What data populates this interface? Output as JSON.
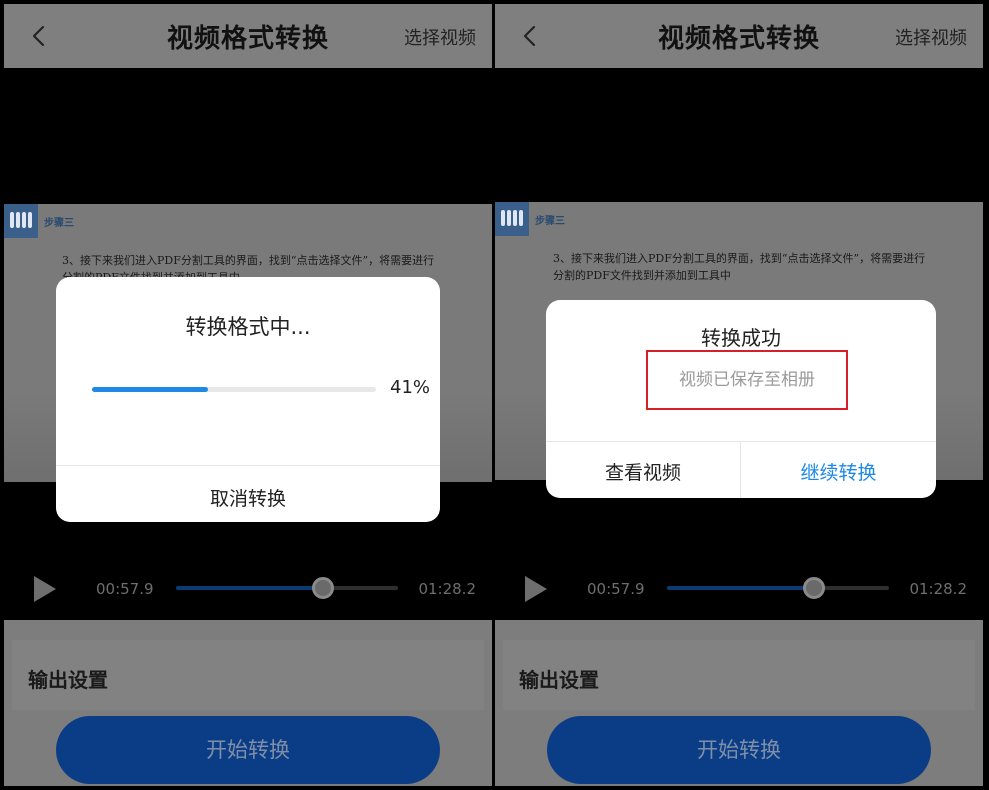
{
  "left": {
    "header": {
      "title": "视频格式转换",
      "select_label": "选择视频"
    },
    "slide": {
      "step": "步骤三",
      "text": "3、接下来我们进入PDF分割工具的界面，找到“点击选择文件”，将需要进行分割的PDF文件找到并添加到工具中"
    },
    "player": {
      "current_time": "00:57.9",
      "total_time": "01:28.2",
      "seek_fraction": 0.66
    },
    "output": {
      "label": "输出设置"
    },
    "start_button": "开始转换",
    "dialog": {
      "title": "转换格式中...",
      "progress_percent": 41,
      "progress_label": "41%",
      "cancel_label": "取消转换"
    }
  },
  "right": {
    "header": {
      "title": "视频格式转换",
      "select_label": "选择视频"
    },
    "slide": {
      "step": "步骤三",
      "text": "3、接下来我们进入PDF分割工具的界面，找到“点击选择文件”，将需要进行分割的PDF文件找到并添加到工具中"
    },
    "player": {
      "current_time": "00:57.9",
      "total_time": "01:28.2",
      "seek_fraction": 0.66
    },
    "output": {
      "label": "输出设置"
    },
    "start_button": "开始转换",
    "dialog": {
      "title": "转换成功",
      "note": "视频已保存至相册",
      "view_label": "查看视频",
      "continue_label": "继续转换"
    }
  },
  "colors": {
    "accent": "#1e88e5",
    "highlight_border": "#d61f26",
    "overlay": "#7f7f7f"
  },
  "icons": {
    "back": "chevron-left-icon",
    "play": "play-icon"
  }
}
